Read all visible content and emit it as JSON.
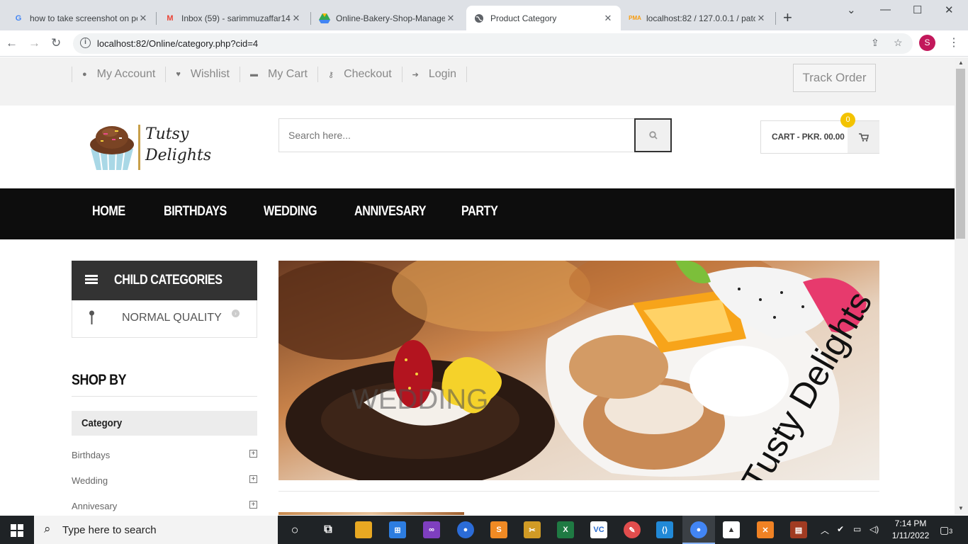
{
  "browser": {
    "tabs": [
      {
        "title": "how to take screenshot on pc",
        "icon": "google-icon"
      },
      {
        "title": "Inbox (59) - sarimmuzaffar14",
        "icon": "gmail-icon"
      },
      {
        "title": "Online-Bakery-Shop-Manage",
        "icon": "drive-icon"
      },
      {
        "title": "Product Category",
        "icon": "globe-icon"
      },
      {
        "title": "localhost:82 / 127.0.0.1 / patc",
        "icon": "phpmyadmin-icon"
      }
    ],
    "url": "localhost:82/Online/category.php?cid=4",
    "profile_initial": "S"
  },
  "topbar": {
    "links": [
      {
        "label": "My Account",
        "icon": "user-icon"
      },
      {
        "label": "Wishlist",
        "icon": "heart-icon"
      },
      {
        "label": "My Cart",
        "icon": "cart-icon"
      },
      {
        "label": "Checkout",
        "icon": "key-icon"
      },
      {
        "label": "Login",
        "icon": "sign-in-icon"
      }
    ],
    "track_order": "Track Order"
  },
  "header": {
    "logo_line1": "Tutsy",
    "logo_line2": "Delights",
    "search_placeholder": "Search here...",
    "cart_label": "CART - PKR. 00.00",
    "cart_count": "0"
  },
  "nav": [
    "HOME",
    "BIRTHDAYS",
    "WEDDING",
    "ANNIVESARY",
    "PARTY"
  ],
  "sidebar": {
    "child_categories_title": "CHILD CATEGORIES",
    "child_item": "NORMAL QUALITY",
    "shop_by": "SHOP BY",
    "category_title": "Category",
    "categories": [
      "Birthdays",
      "Wedding",
      "Annivesary"
    ]
  },
  "banner": {
    "category_text": "WEDDING",
    "brand_text": "Tusty Delights"
  },
  "taskbar": {
    "search_text": "Type here to search",
    "time": "7:14 PM",
    "date": "1/11/2022",
    "notification_count": "3"
  },
  "colors": {
    "navbar": "#0d0d0d",
    "badge": "#f3c300",
    "topbar": "#f2f2f2"
  }
}
